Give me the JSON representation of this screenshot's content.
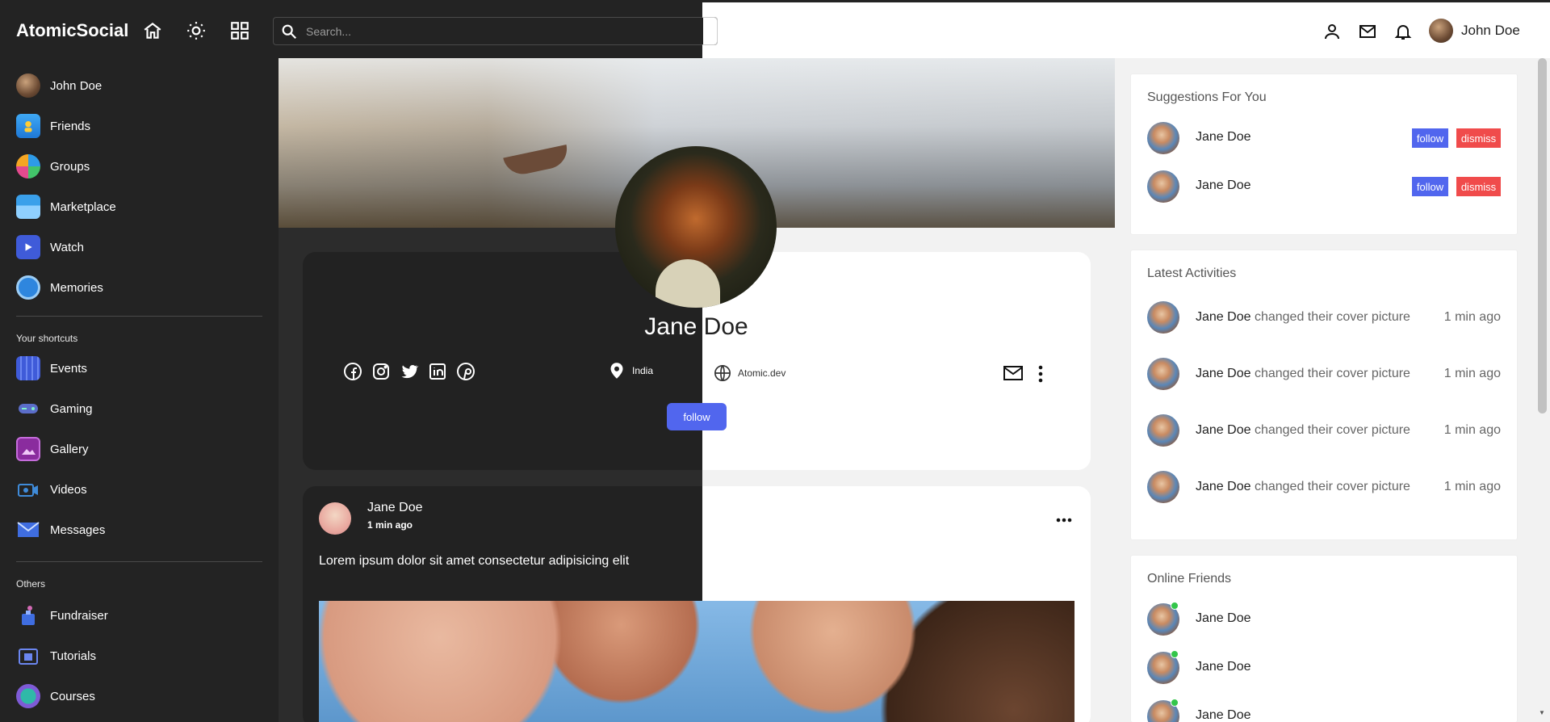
{
  "app": {
    "title": "AtomicSocial"
  },
  "header": {
    "search_placeholder": "Search...",
    "user_name": "John Doe",
    "icons": [
      "home-icon",
      "sun-icon",
      "grid-icon",
      "person-icon",
      "mail-icon",
      "bell-icon"
    ]
  },
  "sidebar": {
    "main_items": [
      {
        "label": "John Doe",
        "icon": "avatar"
      },
      {
        "label": "Friends",
        "icon": "friends-icon"
      },
      {
        "label": "Groups",
        "icon": "groups-icon"
      },
      {
        "label": "Marketplace",
        "icon": "marketplace-icon"
      },
      {
        "label": "Watch",
        "icon": "watch-icon"
      },
      {
        "label": "Memories",
        "icon": "memories-icon"
      }
    ],
    "shortcuts_heading": "Your shortcuts",
    "shortcut_items": [
      {
        "label": "Events",
        "icon": "events-icon"
      },
      {
        "label": "Gaming",
        "icon": "gaming-icon"
      },
      {
        "label": "Gallery",
        "icon": "gallery-icon"
      },
      {
        "label": "Videos",
        "icon": "videos-icon"
      },
      {
        "label": "Messages",
        "icon": "messages-icon"
      }
    ],
    "others_heading": "Others",
    "other_items": [
      {
        "label": "Fundraiser",
        "icon": "fundraiser-icon"
      },
      {
        "label": "Tutorials",
        "icon": "tutorials-icon"
      },
      {
        "label": "Courses",
        "icon": "courses-icon"
      }
    ]
  },
  "profile": {
    "name_dark_part": "Jane ",
    "name_light_part": "Doe",
    "location": "India",
    "website": "Atomic.dev",
    "follow_label": "follow",
    "socials": [
      "facebook-icon",
      "instagram-icon",
      "twitter-icon",
      "linkedin-icon",
      "pinterest-icon"
    ]
  },
  "post": {
    "author": "Jane Doe",
    "time": "1 min ago",
    "text": "Lorem ipsum dolor sit amet consectetur adipisicing elit"
  },
  "suggestions": {
    "title": "Suggestions For You",
    "items": [
      {
        "name": "Jane Doe",
        "follow": "follow",
        "dismiss": "dismiss"
      },
      {
        "name": "Jane Doe",
        "follow": "follow",
        "dismiss": "dismiss"
      }
    ]
  },
  "activities": {
    "title": "Latest Activities",
    "items": [
      {
        "name": "Jane Doe",
        "action": " changed their cover picture",
        "time": "1 min ago"
      },
      {
        "name": "Jane Doe",
        "action": " changed their cover picture",
        "time": "1 min ago"
      },
      {
        "name": "Jane Doe",
        "action": " changed their cover picture",
        "time": "1 min ago"
      },
      {
        "name": "Jane Doe",
        "action": " changed their cover picture",
        "time": "1 min ago"
      }
    ]
  },
  "online_friends": {
    "title": "Online Friends",
    "items": [
      {
        "name": "Jane Doe"
      },
      {
        "name": "Jane Doe"
      },
      {
        "name": "Jane Doe"
      }
    ]
  },
  "colors": {
    "dark": "#232323",
    "accent": "#5166ee",
    "danger": "#f04b4b",
    "online": "#33c64a"
  }
}
